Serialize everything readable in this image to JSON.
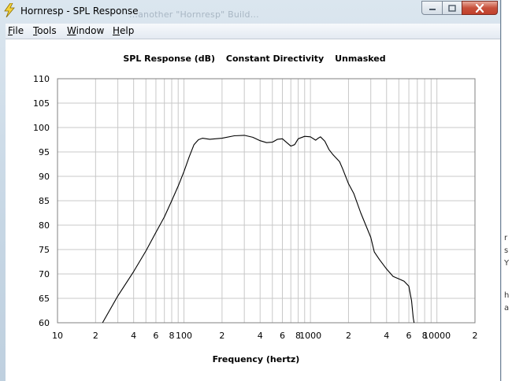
{
  "window": {
    "title": "Hornresp - SPL Response",
    "background_title": "...another \"Hornresp\" Build...",
    "controls": {
      "minimize": "minimize",
      "maximize": "maximize",
      "close": "close"
    }
  },
  "menu": {
    "items": [
      {
        "label": "File",
        "accel": "F",
        "rest": "ile"
      },
      {
        "label": "Tools",
        "accel": "T",
        "rest": "ools"
      },
      {
        "label": "Window",
        "accel": "W",
        "rest": "indow"
      },
      {
        "label": "Help",
        "accel": "H",
        "rest": "elp"
      }
    ]
  },
  "chart_title_parts": [
    "SPL Response (dB)",
    "Constant Directivity",
    "Unmasked"
  ],
  "right_fragments": [
    "r",
    "s",
    "Y",
    "h",
    "a"
  ],
  "colors": {
    "trace": "#000000",
    "grid": "#c8c8c8",
    "frame": "#808080"
  },
  "chart_data": {
    "type": "line",
    "title": "SPL Response (dB) Constant Directivity Unmasked",
    "xlabel": "Frequency (hertz)",
    "ylabel": "",
    "x_scale": "log",
    "xlim": [
      10,
      20000
    ],
    "ylim": [
      60,
      110
    ],
    "grid": true,
    "legend": "none",
    "y_ticks": [
      "110",
      "105",
      "100",
      "95",
      "90",
      "85",
      "80",
      "75",
      "70",
      "65",
      "60"
    ],
    "x_ticks": [
      {
        "value": 10,
        "label": "10"
      },
      {
        "value": 20,
        "label": "2"
      },
      {
        "value": 40,
        "label": "4"
      },
      {
        "value": 60,
        "label": "6"
      },
      {
        "value": 80,
        "label": "8"
      },
      {
        "value": 100,
        "label": "100"
      },
      {
        "value": 200,
        "label": "2"
      },
      {
        "value": 400,
        "label": "4"
      },
      {
        "value": 600,
        "label": "6"
      },
      {
        "value": 800,
        "label": "8"
      },
      {
        "value": 1000,
        "label": "1000"
      },
      {
        "value": 2000,
        "label": "2"
      },
      {
        "value": 4000,
        "label": "4"
      },
      {
        "value": 6000,
        "label": "6"
      },
      {
        "value": 8000,
        "label": "8"
      },
      {
        "value": 10000,
        "label": "10000"
      },
      {
        "value": 20000,
        "label": "2"
      }
    ],
    "series": [
      {
        "x": [
          22.7,
          30,
          40,
          50,
          60,
          70,
          80,
          90,
          100,
          110,
          120,
          130,
          140,
          160,
          200,
          250,
          300,
          350,
          400,
          450,
          500,
          550,
          600,
          700,
          750,
          800,
          900,
          1000,
          1100,
          1150,
          1200,
          1300,
          1400,
          1500,
          1700,
          1800,
          2000,
          2200,
          2500,
          3000,
          3200,
          3500,
          4000,
          4500,
          5000,
          5500,
          6000,
          6300,
          6500,
          6600
        ],
        "y": [
          60,
          65.5,
          70.5,
          74.7,
          78.5,
          81.7,
          85,
          88,
          91,
          94,
          96.5,
          97.5,
          97.8,
          97.6,
          97.8,
          98.3,
          98.4,
          98,
          97.3,
          96.9,
          97,
          97.6,
          97.7,
          96.2,
          96.5,
          97.7,
          98.2,
          98.1,
          97.4,
          97.8,
          98.1,
          97.2,
          95.5,
          94.5,
          93,
          91.5,
          88.5,
          86.5,
          82.5,
          77.5,
          74.5,
          73,
          71,
          69.5,
          69,
          68.5,
          67.5,
          64.5,
          61,
          60
        ]
      }
    ]
  }
}
